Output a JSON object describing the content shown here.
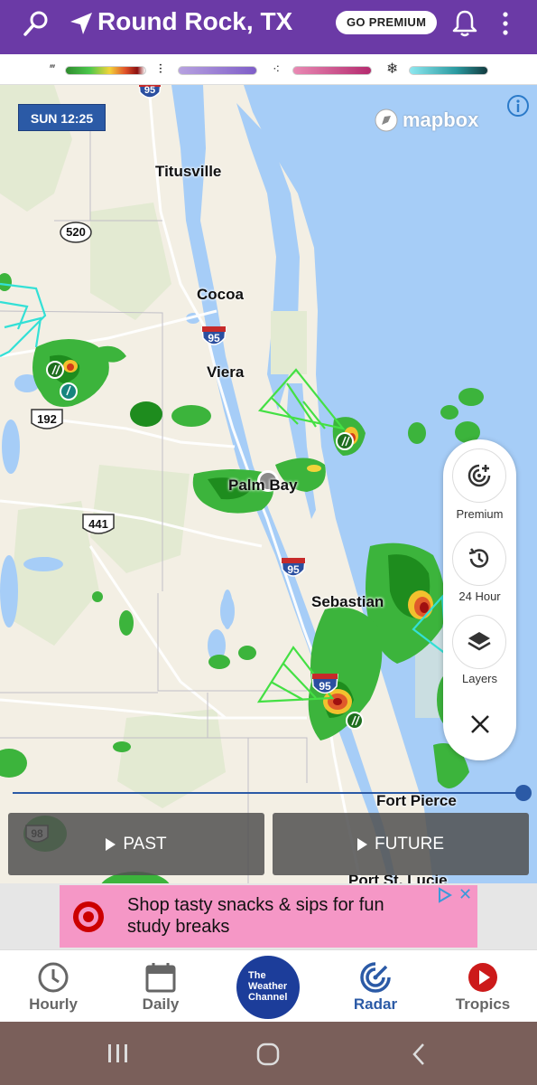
{
  "header": {
    "location": "Round Rock, TX",
    "premium_label": "GO PREMIUM",
    "icons": [
      "search-icon",
      "location-arrow-icon",
      "bell-icon",
      "more-vert-icon"
    ],
    "bg_color": "#6b3aa6"
  },
  "legend": {
    "items": [
      {
        "icon": "rain-icon",
        "gradient": "green-yellow-red"
      },
      {
        "icon": "mix-icon",
        "gradient": "purple"
      },
      {
        "icon": "ice-icon",
        "gradient": "pink"
      },
      {
        "icon": "snow-icon",
        "gradient": "cyan"
      }
    ]
  },
  "map": {
    "timestamp": "SUN 12:25",
    "attribution": "mapbox",
    "cities": [
      "Titusville",
      "Cocoa",
      "Viera",
      "Palm Bay",
      "Sebastian",
      "Fort Pierce",
      "Port St. Lucie"
    ],
    "shields": [
      "95",
      "520",
      "95",
      "192",
      "441",
      "95",
      "95",
      "98"
    ]
  },
  "controls": {
    "premium_label": "Premium",
    "history_label": "24 Hour",
    "layers_label": "Layers"
  },
  "timeline": {
    "past_label": "PAST",
    "future_label": "FUTURE",
    "accent": "#2b5aa6"
  },
  "ad": {
    "text": "Shop tasty snacks & sips for fun study breaks",
    "bg_color": "#f597c6"
  },
  "bottom_nav": {
    "items": [
      {
        "label": "Hourly",
        "icon": "clock-icon",
        "active": false
      },
      {
        "label": "Daily",
        "icon": "calendar-icon",
        "active": false
      },
      {
        "label": "Radar",
        "icon": "radar-icon",
        "active": true
      },
      {
        "label": "Tropics",
        "icon": "play-circle-icon",
        "active": false
      }
    ],
    "logo_lines": [
      "The",
      "Weather",
      "Channel"
    ]
  }
}
